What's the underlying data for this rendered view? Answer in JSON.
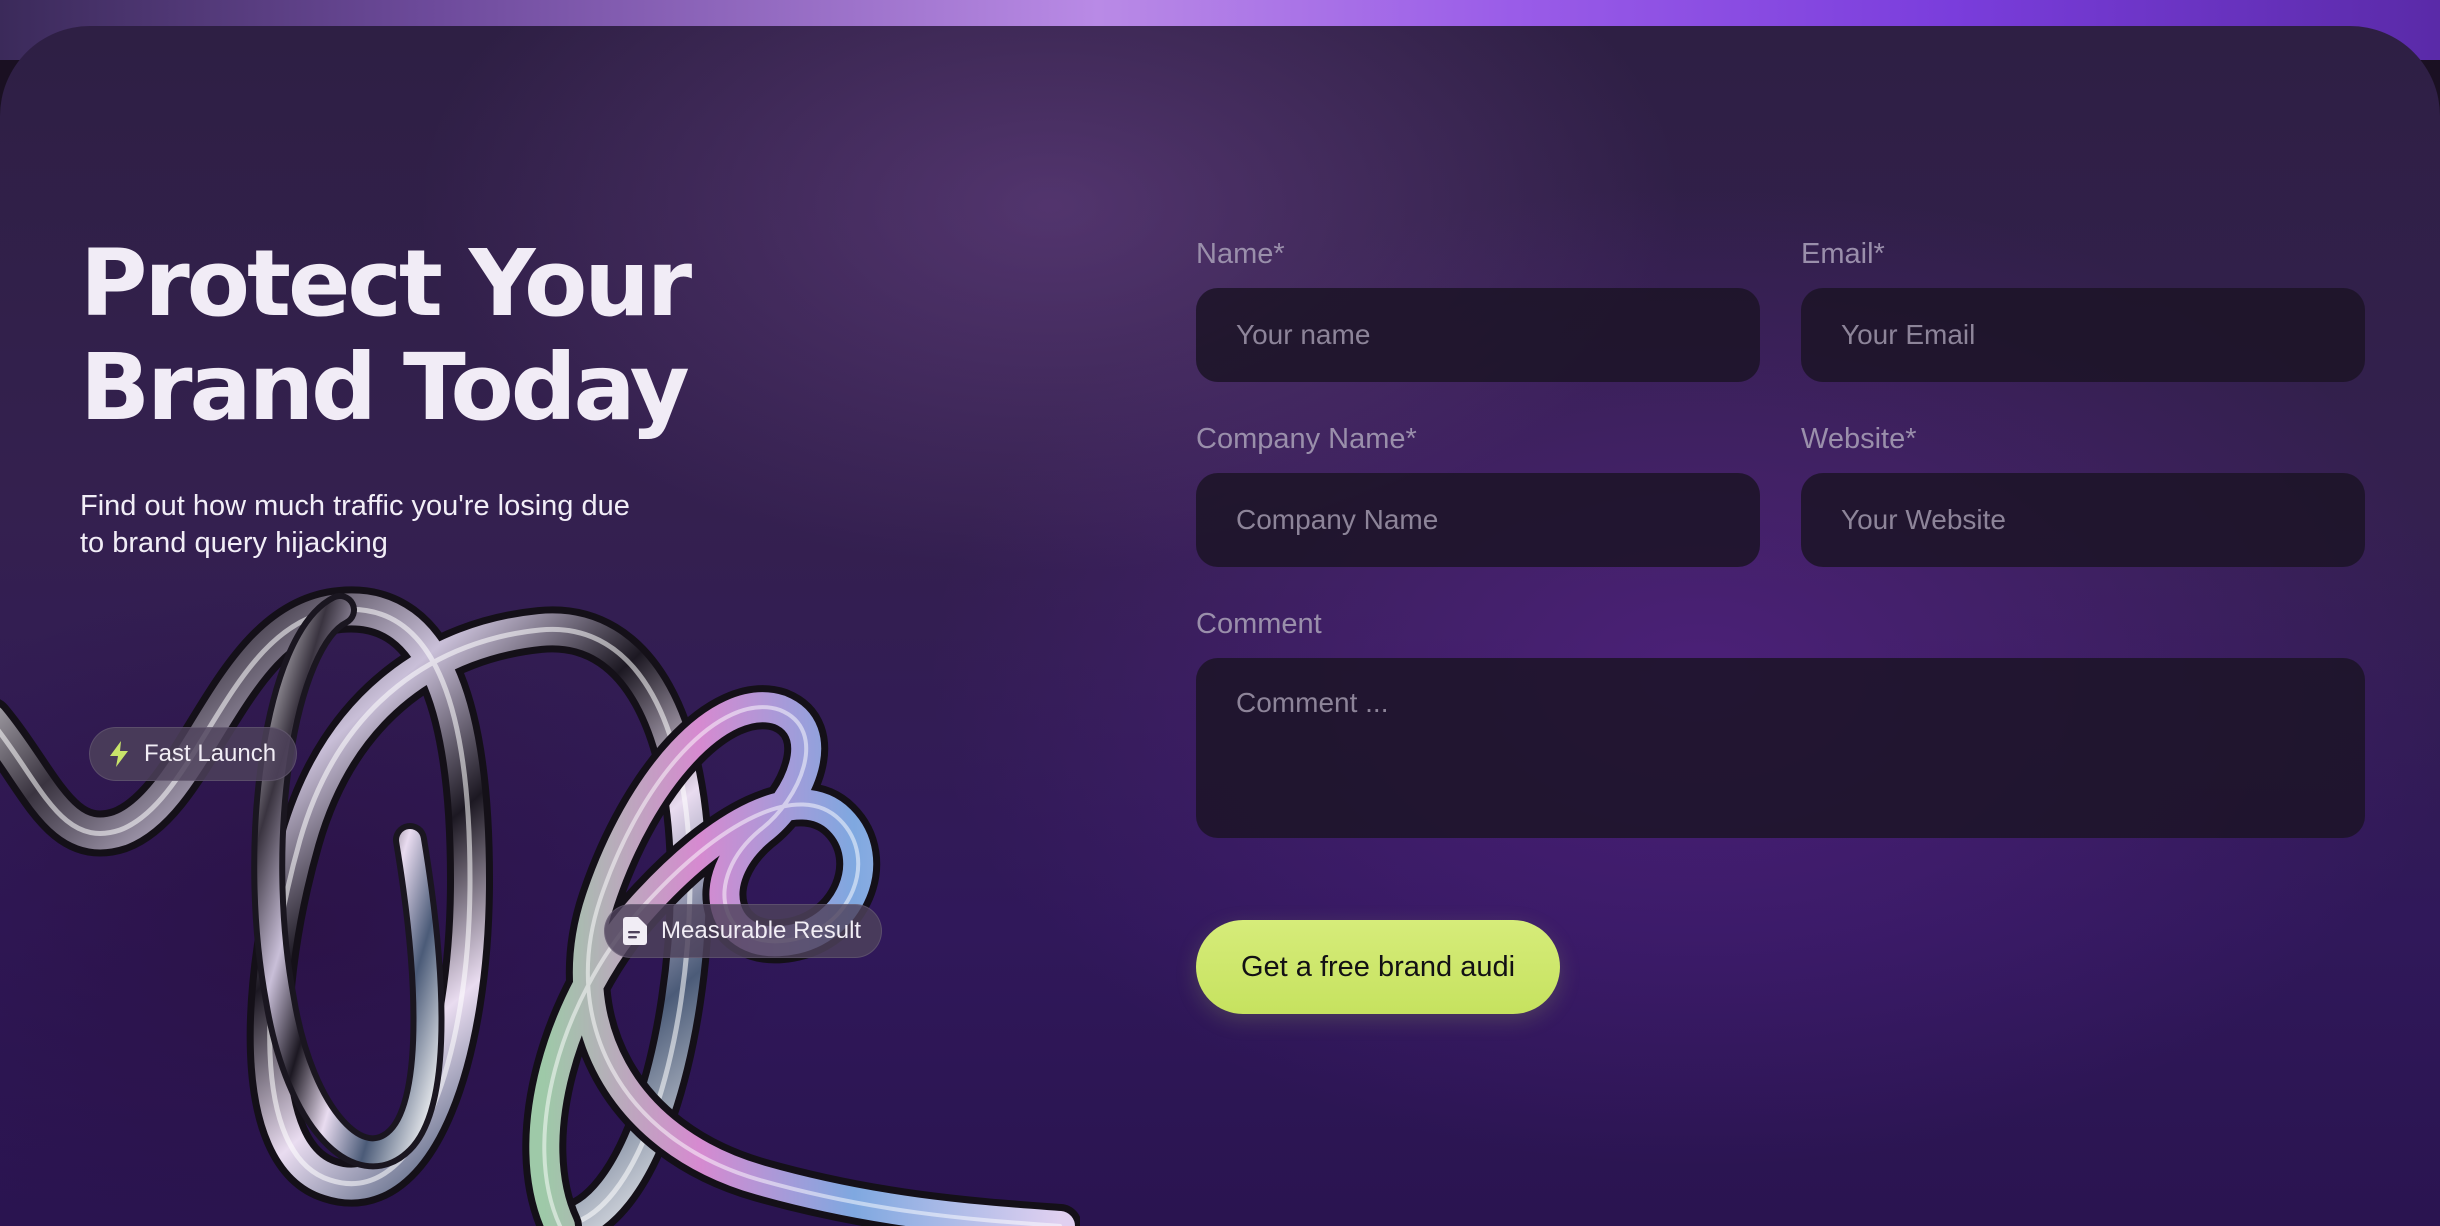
{
  "hero": {
    "title": "Protect Your Brand Today",
    "subtitle": "Find out how much traffic you're losing due to brand query hijacking"
  },
  "badges": {
    "fast_launch": {
      "label": "Fast Launch",
      "icon": "lightning-bolt-icon"
    },
    "measurable_result": {
      "label": "Measurable Result",
      "icon": "document-icon"
    }
  },
  "form": {
    "name": {
      "label": "Name*",
      "placeholder": "Your name"
    },
    "email": {
      "label": "Email*",
      "placeholder": "Your Email"
    },
    "company": {
      "label": "Company Name*",
      "placeholder": "Company Name"
    },
    "website": {
      "label": "Website*",
      "placeholder": "Your Website"
    },
    "comment": {
      "label": "Comment",
      "placeholder": "Comment ..."
    },
    "submit_label": "Get a free brand audi"
  },
  "colors": {
    "accent": "#cde66a",
    "background": "#30185a",
    "top_strip": "#9a5ce8"
  }
}
